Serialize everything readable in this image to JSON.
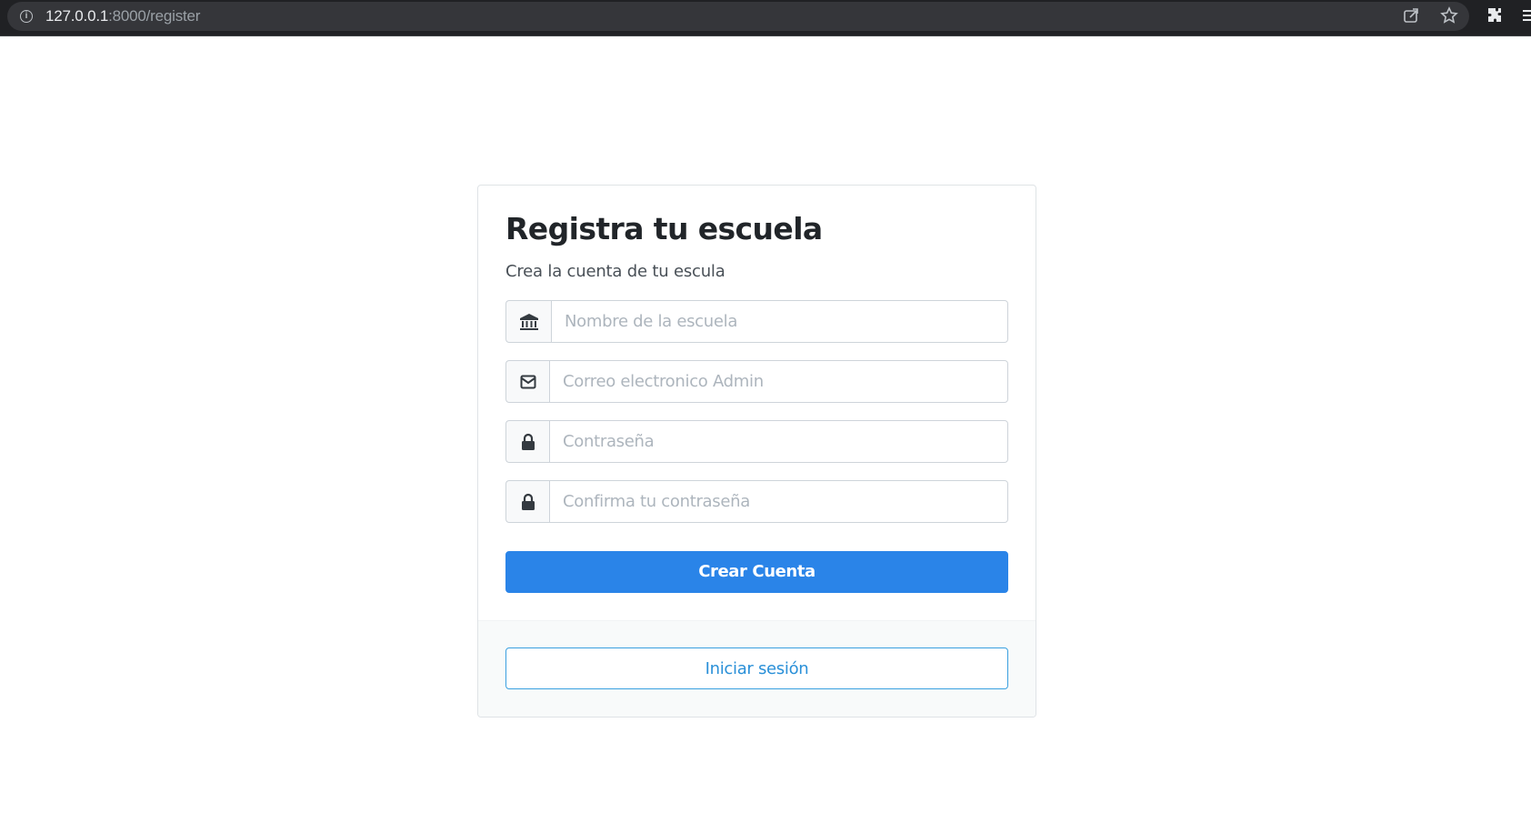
{
  "browser": {
    "url_host": "127.0.0.1",
    "url_path": ":8000/register",
    "info_icon": "info-icon",
    "icons": [
      "share-icon",
      "star-icon",
      "extensions-icon",
      "menu-icon"
    ]
  },
  "form": {
    "title": "Registra tu escuela",
    "subtitle": "Crea la cuenta de tu escula",
    "fields": [
      {
        "icon": "bank-icon",
        "placeholder": "Nombre de la escuela",
        "value": ""
      },
      {
        "icon": "envelope-icon",
        "placeholder": "Correo electronico Admin",
        "value": ""
      },
      {
        "icon": "lock-icon",
        "placeholder": "Contraseña",
        "value": ""
      },
      {
        "icon": "lock-icon",
        "placeholder": "Confirma tu contraseña",
        "value": ""
      }
    ],
    "submit_label": "Crear Cuenta",
    "login_label": "Iniciar sesión"
  },
  "colors": {
    "primary": "#2a84e8",
    "outline": "#3aa0e0",
    "chrome_bg": "#202124"
  }
}
